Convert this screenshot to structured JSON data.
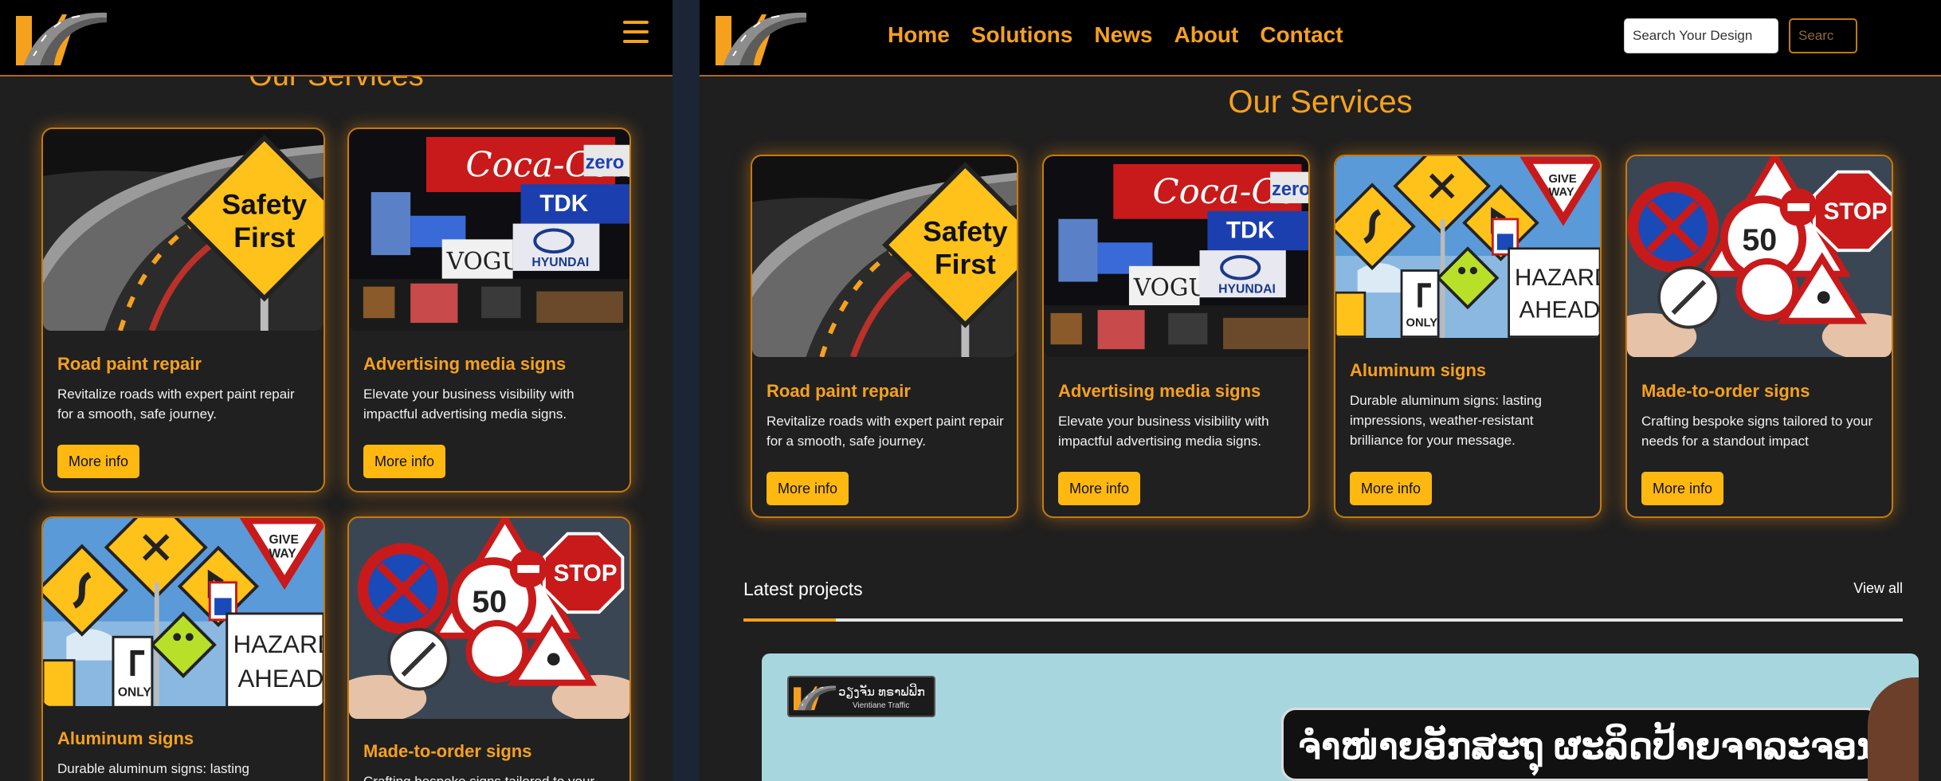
{
  "brand": {
    "accent": "#f6a11e",
    "button": "#ffb80f",
    "card_border": "#c47a12"
  },
  "mobile": {
    "menu_icon": "hamburger-icon",
    "section_title": "Our Services",
    "cards": [
      {
        "title": "Road paint repair",
        "desc": "Revitalize roads with expert paint repair for a smooth, safe journey.",
        "button": "More info",
        "image": "safety-first-road"
      },
      {
        "title": "Advertising media signs",
        "desc": "Elevate your business visibility with impactful advertising media signs.",
        "button": "More info",
        "image": "billboards-night"
      },
      {
        "title": "Aluminum signs",
        "desc": "Durable aluminum signs: lasting",
        "image": "traffic-sign-cluster"
      },
      {
        "title": "Made-to-order signs",
        "desc": "Crafting bespoke signs tailored to your",
        "image": "signs-in-hands"
      }
    ]
  },
  "desktop": {
    "nav": [
      "Home",
      "Solutions",
      "News",
      "About",
      "Contact"
    ],
    "search": {
      "placeholder": "Search Your Design",
      "button": "Searc"
    },
    "section_title": "Our Services",
    "cards": [
      {
        "title": "Road paint repair",
        "desc": "Revitalize roads with expert paint repair for a smooth, safe journey.",
        "button": "More info"
      },
      {
        "title": "Advertising media signs",
        "desc": "Elevate your business visibility with impactful advertising media signs.",
        "button": "More info"
      },
      {
        "title": "Aluminum signs",
        "desc": "Durable aluminum signs: lasting impressions, weather-resistant brilliance for your message.",
        "button": "More info"
      },
      {
        "title": "Made-to-order signs",
        "desc": "Crafting bespoke signs tailored to your needs for a standout impact",
        "button": "More info"
      }
    ],
    "latest": {
      "title": "Latest projects",
      "view_all": "View all"
    },
    "banner": {
      "logo_text": "ວຽງຈັນ ທຣາຟຟິກ",
      "logo_sub": "Vientiane Traffic",
      "headline": "ຈຳໜ່າຍອັກສະຖຸ ຜະລິດປ້າຍຈາລະຈອນ"
    }
  }
}
